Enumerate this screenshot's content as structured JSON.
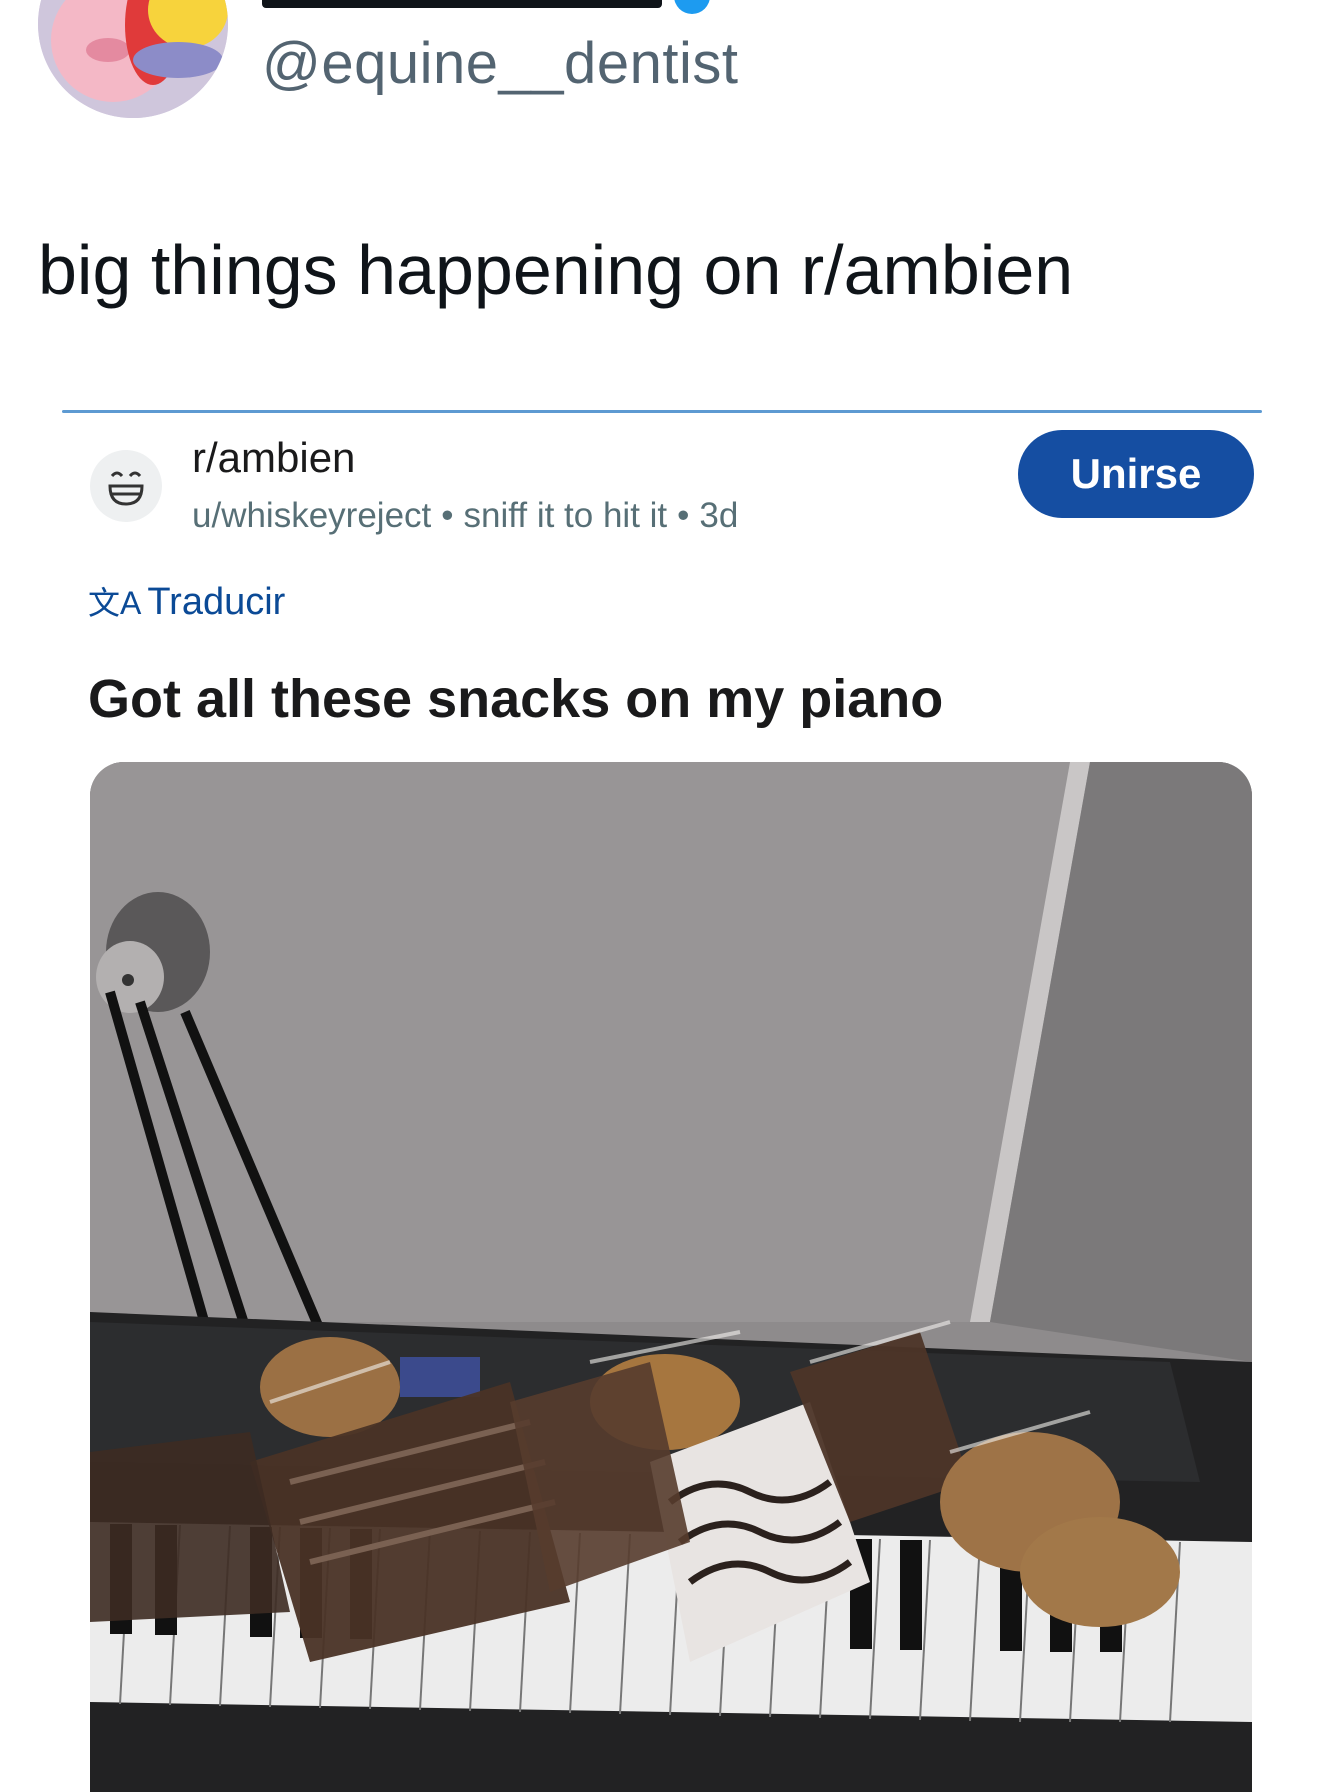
{
  "tweet": {
    "handle": "@equine__dentist",
    "text": "big things happening on r/ambien"
  },
  "embed": {
    "subreddit": "r/ambien",
    "username": "u/whiskeyreject",
    "flair": "sniff it to hit it",
    "age": "3d",
    "separator": "•",
    "join_label": "Unirse",
    "translate_icon": "文A",
    "translate_label": "Traducir",
    "post_title": "Got all these snacks on my piano"
  },
  "colors": {
    "join_button": "#154ea2",
    "translate_link": "#0b4a96",
    "embed_top_border": "#5d9ad2"
  }
}
